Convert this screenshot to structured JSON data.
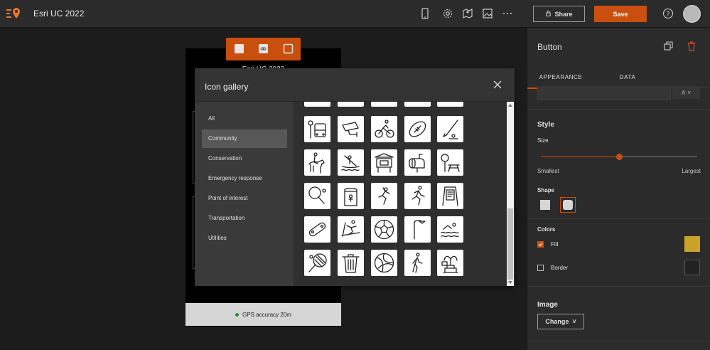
{
  "header": {
    "app_title": "Esri UC 2022",
    "share_label": "Share",
    "save_label": "Save",
    "icons": [
      "logo-icon",
      "mobile-preview-icon",
      "settings-icon",
      "map-pin-icon",
      "image-icon",
      "more-icon",
      "help-icon"
    ]
  },
  "canvas": {
    "phone_title": "Esri UC 2022",
    "gps_label": "GPS accuracy 20m",
    "floating_toolbar": [
      "select-icon",
      "link-icon",
      "duplicate-icon"
    ]
  },
  "modal": {
    "title": "Icon gallery",
    "categories": [
      {
        "label": "All",
        "selected": false
      },
      {
        "label": "Community",
        "selected": true
      },
      {
        "label": "Conservation",
        "selected": false
      },
      {
        "label": "Emergency response",
        "selected": false
      },
      {
        "label": "Point of interest",
        "selected": false
      },
      {
        "label": "Transportation",
        "selected": false
      },
      {
        "label": "Utilities",
        "selected": false
      }
    ],
    "icons": [
      [
        "bus-stop-icon",
        "security-camera-icon",
        "cyclist-icon",
        "football-icon",
        "golf-icon"
      ],
      [
        "horse-riding-icon",
        "kayak-icon",
        "kiosk-icon",
        "mailbox-icon",
        "picnic-area-icon"
      ],
      [
        "table-tennis-icon",
        "portable-toilet-icon",
        "rock-climbing-icon",
        "running-icon",
        "sign-board-icon"
      ],
      [
        "skateboard-icon",
        "skiing-icon",
        "soccer-ball-icon",
        "street-light-icon",
        "swimming-icon"
      ],
      [
        "tennis-icon",
        "trash-can-icon",
        "volleyball-icon",
        "walking-icon",
        "fountain-icon"
      ]
    ]
  },
  "panel": {
    "title": "Button",
    "tabs": [
      {
        "label": "APPEARANCE",
        "active": true
      },
      {
        "label": "DATA",
        "active": false
      }
    ],
    "text_style_select": "A",
    "style_heading": "Style",
    "size_label": "Size",
    "size_min_label": "Smallest",
    "size_max_label": "Largest",
    "size_value": 0.5,
    "shape_label": "Shape",
    "shape_selected": "rounded",
    "colors_label": "Colors",
    "fill_label": "Fill",
    "fill_checked": true,
    "fill_color": "#c9a227",
    "border_label": "Border",
    "border_checked": false,
    "image_heading": "Image",
    "change_label": "Change"
  },
  "colors": {
    "accent": "#c94f0f",
    "panel_bg": "#2b2b2b",
    "modal_bg": "#333333"
  }
}
